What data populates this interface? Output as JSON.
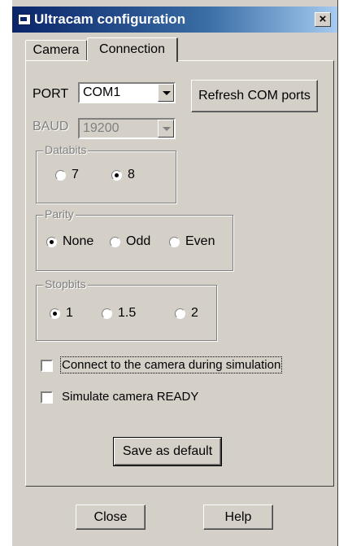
{
  "window": {
    "title": "Ultracam configuration",
    "close_label": "×"
  },
  "tabs": [
    {
      "label": "Camera",
      "active": false
    },
    {
      "label": "Connection",
      "active": true
    }
  ],
  "connection": {
    "port_label": "PORT",
    "port_value": "COM1",
    "refresh_label": "Refresh COM ports",
    "baud_label": "BAUD",
    "baud_value": "19200",
    "databits": {
      "title": "Databits",
      "options": [
        "7",
        "8"
      ],
      "selected": "8"
    },
    "parity": {
      "title": "Parity",
      "options": [
        "None",
        "Odd",
        "Even"
      ],
      "selected": "None"
    },
    "stopbits": {
      "title": "Stopbits",
      "options": [
        "1",
        "1.5",
        "2"
      ],
      "selected": "1"
    },
    "connect_sim_label": "Connect to the camera during simulation",
    "connect_sim_checked": false,
    "simulate_ready_label": "Simulate camera READY",
    "simulate_ready_checked": false,
    "save_default_label": "Save as default"
  },
  "footer": {
    "close_label": "Close",
    "help_label": "Help"
  }
}
